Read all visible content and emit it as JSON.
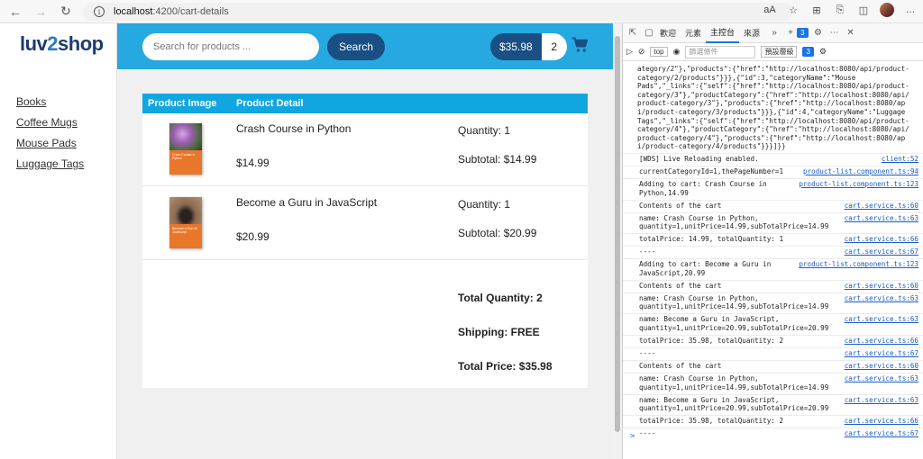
{
  "browser": {
    "url_host": "localhost",
    "url_path": ":4200/cart-details",
    "right_icons": [
      "aA",
      "☆",
      "⊞",
      "⎘",
      "◫",
      "…"
    ]
  },
  "sidebar": {
    "logo_a": "luv",
    "logo_b": "2",
    "logo_c": "shop",
    "items": [
      {
        "label": "Books"
      },
      {
        "label": "Coffee Mugs"
      },
      {
        "label": "Mouse Pads"
      },
      {
        "label": "Luggage Tags"
      }
    ]
  },
  "header": {
    "search_placeholder": "Search for products ...",
    "search_button": "Search",
    "cart_total": "$35.98",
    "cart_quantity": "2"
  },
  "cart": {
    "col_image": "Product Image",
    "col_detail": "Product Detail",
    "items": [
      {
        "name": "Crash Course in Python",
        "price": "$14.99",
        "quantity": "Quantity: 1",
        "subtotal": "Subtotal: $14.99",
        "cover_title": "Crash Course in Python"
      },
      {
        "name": "Become a Guru in JavaScript",
        "price": "$20.99",
        "quantity": "Quantity: 1",
        "subtotal": "Subtotal: $20.99",
        "cover_title": "Become a Guru in JavaScript"
      }
    ],
    "total_quantity": "Total Quantity: 2",
    "shipping": "Shipping: FREE",
    "total_price": "Total Price: $35.98"
  },
  "devtools": {
    "tabs": [
      "歡迎",
      "元素",
      "主控台",
      "來源"
    ],
    "active_tab": "主控台",
    "badge": "3",
    "context": "top",
    "filter_placeholder": "篩選條件",
    "levels": "預設層級",
    "raw_lines": [
      "ategory/2\"},\"products\":{\"href\":\"http://localhost:8080/api/product-",
      "category/2/products\"}}},{\"id\":3,\"categoryName\":\"Mouse",
      "Pads\",\"_links\":{\"self\":{\"href\":\"http://localhost:8080/api/product-",
      "category/3\"},\"productCategory\":{\"href\":\"http://localhost:8080/api/",
      "product-category/3\"},\"products\":{\"href\":\"http://localhost:8080/ap",
      "i/product-category/3/products\"}}},{\"id\":4,\"categoryName\":\"Luggage",
      "Tags\",\"_links\":{\"self\":{\"href\":\"http://localhost:8080/api/product-",
      "category/4\"},\"productCategory\":{\"href\":\"http://localhost:8080/api/",
      "product-category/4\"},\"products\":{\"href\":\"http://localhost:8080/ap",
      "i/product-category/4/products\"}}}]}}"
    ],
    "logs": [
      {
        "text": "[WDS] Live Reloading enabled.",
        "src": "client:52"
      },
      {
        "text": "currentCategoryId=1,thePageNumber=1",
        "src": "product-list.component.ts:94"
      },
      {
        "text": "Adding to cart: Crash Course in\nPython,14.99",
        "src": "product-list.component.ts:123"
      },
      {
        "text": "Contents of the cart",
        "src": "cart.service.ts:60"
      },
      {
        "text": "name: Crash Course in Python,\nquantity=1,unitPrice=14.99,subTotalPrice=14.99",
        "src": "cart.service.ts:63"
      },
      {
        "text": "totalPrice: 14.99, totalQuantity: 1",
        "src": "cart.service.ts:66"
      },
      {
        "text": "----",
        "src": "cart.service.ts:67"
      },
      {
        "text": "Adding to cart: Become a Guru in\nJavaScript,20.99",
        "src": "product-list.component.ts:123"
      },
      {
        "text": "Contents of the cart",
        "src": "cart.service.ts:60"
      },
      {
        "text": "name: Crash Course in Python,\nquantity=1,unitPrice=14.99,subTotalPrice=14.99",
        "src": "cart.service.ts:63"
      },
      {
        "text": "name: Become a Guru in JavaScript,\nquantity=1,unitPrice=20.99,subTotalPrice=20.99",
        "src": "cart.service.ts:63"
      },
      {
        "text": "totalPrice: 35.98, totalQuantity: 2",
        "src": "cart.service.ts:66"
      },
      {
        "text": "----",
        "src": "cart.service.ts:67"
      },
      {
        "text": "Contents of the cart",
        "src": "cart.service.ts:60"
      },
      {
        "text": "name: Crash Course in Python,\nquantity=1,unitPrice=14.99,subTotalPrice=14.99",
        "src": "cart.service.ts:63"
      },
      {
        "text": "name: Become a Guru in JavaScript,\nquantity=1,unitPrice=20.99,subTotalPrice=20.99",
        "src": "cart.service.ts:63"
      },
      {
        "text": "totalPrice: 35.98, totalQuantity: 2",
        "src": "cart.service.ts:66"
      },
      {
        "text": "----",
        "src": "cart.service.ts:67"
      }
    ],
    "prompt": ">"
  }
}
